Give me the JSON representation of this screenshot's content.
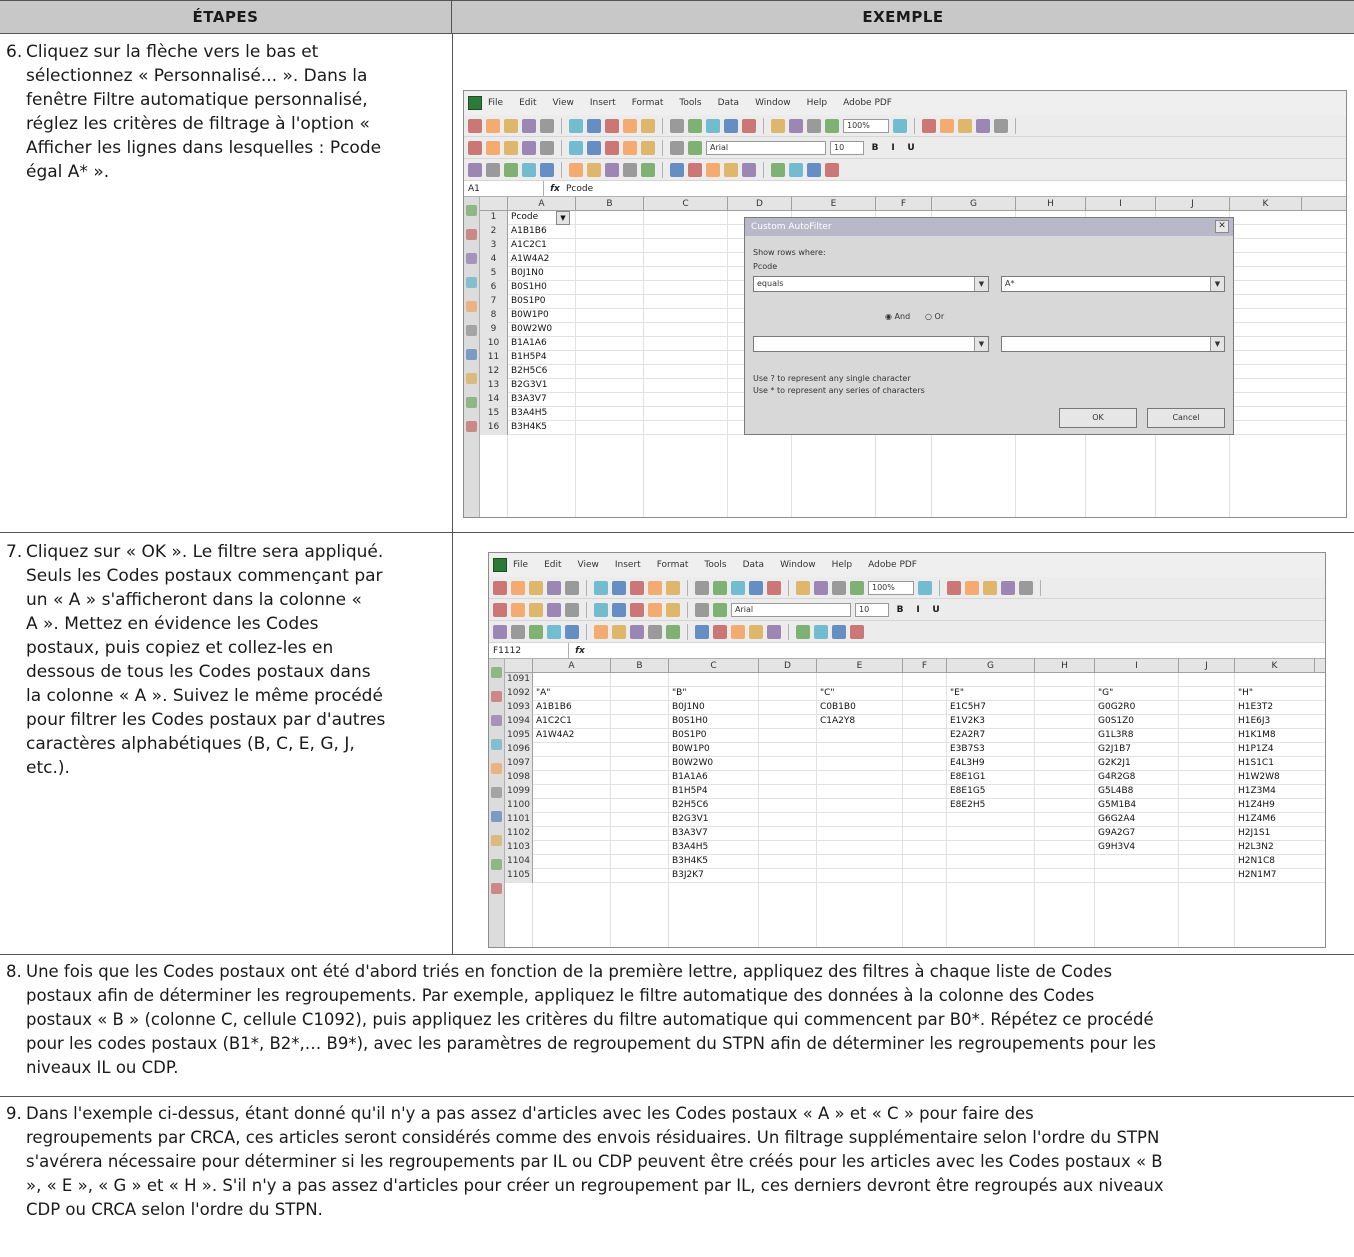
{
  "header": {
    "col_steps": "ÉTAPES",
    "col_example": "EXEMPLE"
  },
  "steps": {
    "s6": {
      "num": "6.",
      "lines": [
        "Cliquez sur la flèche vers le bas et",
        "sélectionnez « Personnalisé... ». Dans la",
        "fenêtre Filtre automatique personnalisé,",
        "réglez les critères de filtrage à l'option «",
        "Afficher les lignes dans lesquelles : Pcode",
        "égal A* »."
      ]
    },
    "s7": {
      "num": "7.",
      "lines": [
        "Cliquez sur « OK ». Le filtre sera appliqué.",
        "Seuls les Codes postaux commençant par",
        "un « A » s'afficheront dans la colonne «",
        "A ». Mettez en évidence les Codes",
        "postaux, puis copiez et collez-les en",
        "dessous de tous les Codes postaux dans",
        "la colonne « A ». Suivez le même procédé",
        "pour filtrer les Codes postaux par d'autres",
        "caractères alphabétiques (B, C, E, G, J,",
        "etc.)."
      ]
    },
    "s8": {
      "num": "8.",
      "lines": [
        "Une fois que les Codes postaux ont été d'abord triés en fonction de la première lettre, appliquez des filtres à chaque liste de Codes",
        "postaux afin de déterminer les regroupements. Par exemple, appliquez le filtre automatique des données à la colonne des Codes",
        "postaux « B » (colonne C, cellule C1092), puis appliquez les critères du filtre automatique qui commencent par B0*. Répétez ce procédé",
        "pour les codes postaux (B1*, B2*,… B9*), avec les paramètres de regroupement du STPN afin de déterminer les regroupements pour les",
        "niveaux IL ou CDP."
      ]
    },
    "s9": {
      "num": "9.",
      "lines": [
        "Dans l'exemple ci-dessus, étant donné qu'il n'y a pas assez d'articles avec les Codes postaux « A » et « C » pour faire des",
        "regroupements par CRCA, ces articles seront considérés comme des envois résiduaires. Un filtrage supplémentaire selon l'ordre du STPN",
        "s'avérera nécessaire pour déterminer si les regroupements par IL ou CDP peuvent être créés pour les articles avec les Codes postaux « B",
        "», « E », « G » et « H ». S'il n'y a pas assez d'articles pour créer un regroupement par IL, ces derniers devront être regroupés aux niveaux",
        "CDP ou CRCA selon l'ordre du STPN."
      ]
    }
  },
  "excel": {
    "menu": [
      "File",
      "Edit",
      "View",
      "Insert",
      "Format",
      "Tools",
      "Data",
      "Window",
      "Help",
      "Adobe PDF"
    ],
    "font_name": "Arial",
    "font_size": "10",
    "zoom": "100%",
    "columns": [
      "A",
      "B",
      "C",
      "D",
      "E",
      "F",
      "G",
      "H",
      "I",
      "J",
      "K"
    ],
    "shot1": {
      "cell_ref": "A1",
      "formula": "Pcode",
      "rows": [
        [
          "1",
          "Pcode"
        ],
        [
          "2",
          "A1B1B6"
        ],
        [
          "3",
          "A1C2C1"
        ],
        [
          "4",
          "A1W4A2"
        ],
        [
          "5",
          "B0J1N0"
        ],
        [
          "6",
          "B0S1H0"
        ],
        [
          "7",
          "B0S1P0"
        ],
        [
          "8",
          "B0W1P0"
        ],
        [
          "9",
          "B0W2W0"
        ],
        [
          "10",
          "B1A1A6"
        ],
        [
          "11",
          "B1H5P4"
        ],
        [
          "12",
          "B2H5C6"
        ],
        [
          "13",
          "B2G3V1"
        ],
        [
          "14",
          "B3A3V7"
        ],
        [
          "15",
          "B3A4H5"
        ],
        [
          "16",
          "B3H4K5"
        ]
      ],
      "dialog": {
        "title": "Custom AutoFilter",
        "show_rows": "Show rows where:",
        "field": "Pcode",
        "op1": "equals",
        "val1": "A*",
        "and_label": "And",
        "or_label": "Or",
        "hint1": "Use ? to represent any single character",
        "hint2": "Use * to represent any series of characters",
        "ok": "OK",
        "cancel": "Cancel"
      }
    },
    "shot2": {
      "cell_ref": "F1112",
      "rows": [
        {
          "n": "1091",
          "A": "",
          "C": "",
          "E": "",
          "G": "",
          "I": "",
          "K": ""
        },
        {
          "n": "1092",
          "A": "\"A\"",
          "C": "\"B\"",
          "E": "\"C\"",
          "G": "\"E\"",
          "I": "\"G\"",
          "K": "\"H\""
        },
        {
          "n": "1093",
          "A": "A1B1B6",
          "C": "B0J1N0",
          "E": "C0B1B0",
          "G": "E1C5H7",
          "I": "G0G2R0",
          "K": "H1E3T2"
        },
        {
          "n": "1094",
          "A": "A1C2C1",
          "C": "B0S1H0",
          "E": "C1A2Y8",
          "G": "E1V2K3",
          "I": "G0S1Z0",
          "K": "H1E6J3"
        },
        {
          "n": "1095",
          "A": "A1W4A2",
          "C": "B0S1P0",
          "E": "",
          "G": "E2A2R7",
          "I": "G1L3R8",
          "K": "H1K1M8"
        },
        {
          "n": "1096",
          "A": "",
          "C": "B0W1P0",
          "E": "",
          "G": "E3B7S3",
          "I": "G2J1B7",
          "K": "H1P1Z4"
        },
        {
          "n": "1097",
          "A": "",
          "C": "B0W2W0",
          "E": "",
          "G": "E4L3H9",
          "I": "G2K2J1",
          "K": "H1S1C1"
        },
        {
          "n": "1098",
          "A": "",
          "C": "B1A1A6",
          "E": "",
          "G": "E8E1G1",
          "I": "G4R2G8",
          "K": "H1W2W8"
        },
        {
          "n": "1099",
          "A": "",
          "C": "B1H5P4",
          "E": "",
          "G": "E8E1G5",
          "I": "G5L4B8",
          "K": "H1Z3M4"
        },
        {
          "n": "1100",
          "A": "",
          "C": "B2H5C6",
          "E": "",
          "G": "E8E2H5",
          "I": "G5M1B4",
          "K": "H1Z4H9"
        },
        {
          "n": "1101",
          "A": "",
          "C": "B2G3V1",
          "E": "",
          "G": "",
          "I": "G6G2A4",
          "K": "H1Z4M6"
        },
        {
          "n": "1102",
          "A": "",
          "C": "B3A3V7",
          "E": "",
          "G": "",
          "I": "G9A2G7",
          "K": "H2J1S1"
        },
        {
          "n": "1103",
          "A": "",
          "C": "B3A4H5",
          "E": "",
          "G": "",
          "I": "G9H3V4",
          "K": "H2L3N2"
        },
        {
          "n": "1104",
          "A": "",
          "C": "B3H4K5",
          "E": "",
          "G": "",
          "I": "",
          "K": "H2N1C8"
        },
        {
          "n": "1105",
          "A": "",
          "C": "B3J2K7",
          "E": "",
          "G": "",
          "I": "",
          "K": "H2N1M7"
        }
      ]
    }
  }
}
